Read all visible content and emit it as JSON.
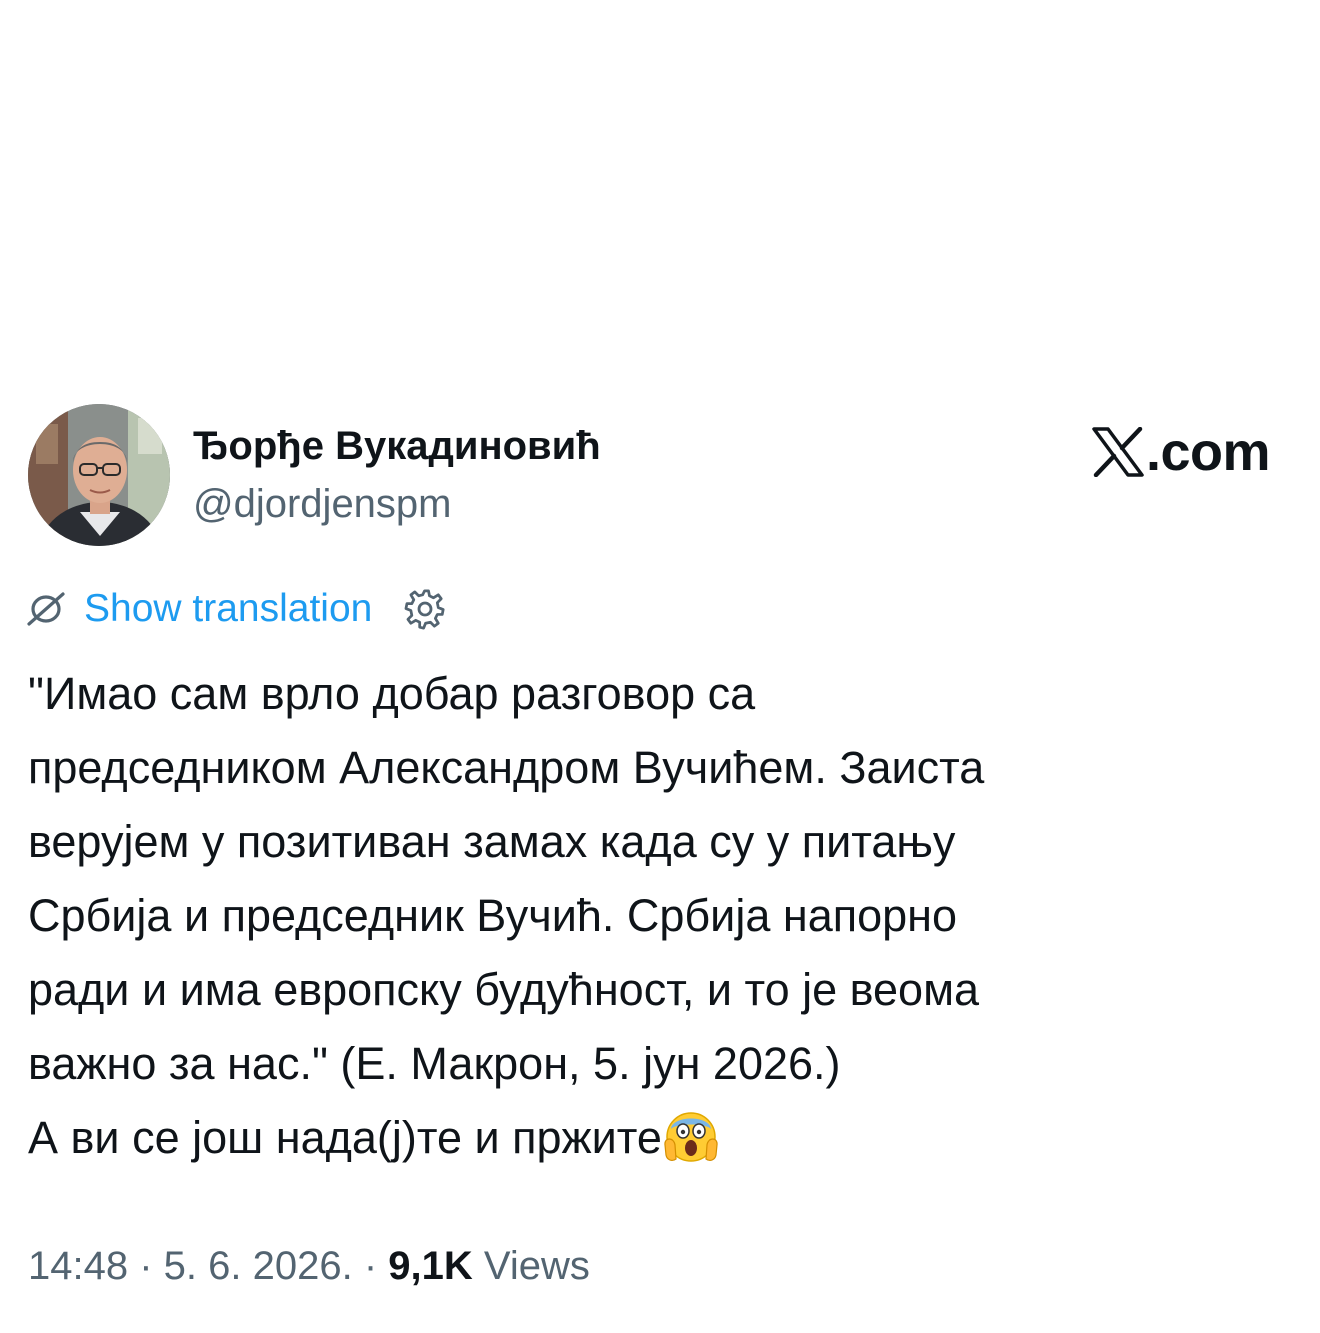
{
  "author": {
    "display_name": "Ђорђе Вукадиновић",
    "handle": "@djordjenspm"
  },
  "brand": {
    "domain_text": ".com",
    "logo_icon": "x-logo-icon"
  },
  "translation": {
    "link_label": "Show translation",
    "icon": "translate-icon",
    "settings_icon": "gear-icon"
  },
  "tweet": {
    "lines": [
      "\"Имао сам врло добар разговор са",
      "председником Александром Вучићем. Заиста",
      "верујем у позитиван замах када су у питању",
      "Србија и председник Вучић. Србија напорно",
      "ради и има европску будућност, и то је веома",
      "важно за нас.\" (Е. Макрон, 5. јун 2026.)",
      "А ви се још нада(ј)те и пржите"
    ],
    "emoji": "😱"
  },
  "meta": {
    "time": "14:48",
    "separator": " · ",
    "date": "5. 6. 2026.",
    "views_count": "9,1K",
    "views_label": " Views"
  },
  "colors": {
    "link": "#1d9bf0",
    "secondary_text": "#536471",
    "primary_text": "#0f1419"
  }
}
